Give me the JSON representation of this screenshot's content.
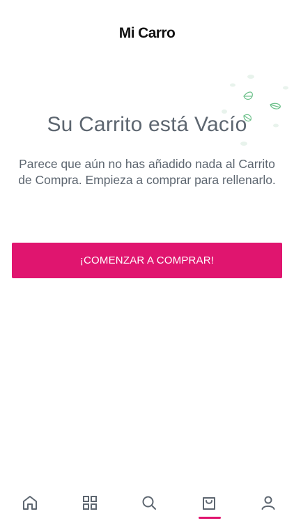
{
  "header": {
    "title": "Mi Carro"
  },
  "empty_state": {
    "title": "Su Carrito está Vacío",
    "description": "Parece que aún no has añadido nada al Carrito de Compra. Empieza a comprar para rellenarlo.",
    "cta_label": "¡COMENZAR A COMPRAR!"
  },
  "tabbar": {
    "tabs": [
      {
        "icon": "home-icon"
      },
      {
        "icon": "grid-icon"
      },
      {
        "icon": "search-icon"
      },
      {
        "icon": "shopping-bag-icon",
        "active": true
      },
      {
        "icon": "user-icon"
      }
    ]
  },
  "colors": {
    "accent": "#e0156f",
    "text": "#5d6670",
    "icon": "#5d6670",
    "leaf": "#6cc08a"
  }
}
